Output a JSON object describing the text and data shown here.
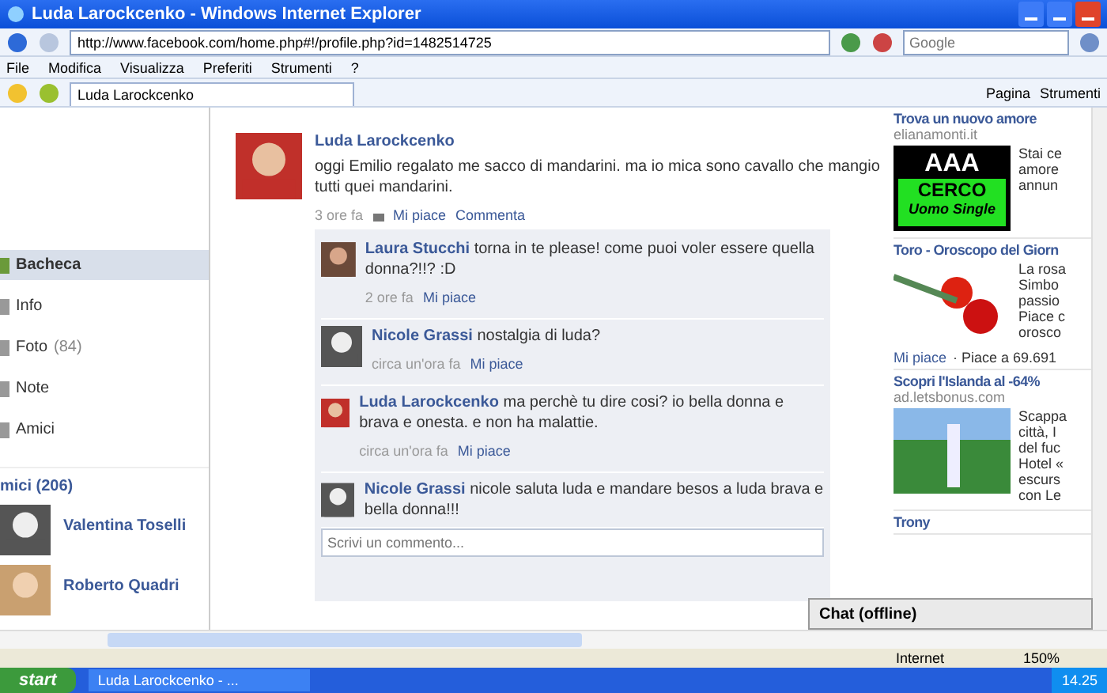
{
  "window": {
    "title": "Luda Larockcenko - Windows Internet Explorer"
  },
  "address_bar": {
    "url": "http://www.facebook.com/home.php#!/profile.php?id=1482514725",
    "search_placeholder": "Google"
  },
  "menu": [
    "File",
    "Modifica",
    "Visualizza",
    "Preferiti",
    "Strumenti",
    "?"
  ],
  "tabs": [
    {
      "label": "Luda Larockcenko",
      "selected": true
    }
  ],
  "command_bar": [
    "Pagina",
    "Strumenti"
  ],
  "sidebar": {
    "items": [
      {
        "label": "Bacheca",
        "selected": true
      },
      {
        "label": "Info",
        "selected": false
      },
      {
        "label": "Foto",
        "count": "(84)",
        "selected": false
      },
      {
        "label": "Note",
        "selected": false
      },
      {
        "label": "Amici",
        "selected": false
      }
    ],
    "friends_title": "mici (206)",
    "friends": [
      {
        "name": "Valentina Toselli"
      },
      {
        "name": "Roberto Quadri"
      }
    ]
  },
  "post": {
    "author": "Luda Larockcenko",
    "text": "oggi Emilio regalato me sacco di mandarini. ma io mica sono cavallo che mangio tutti  quei mandarini.",
    "time": "3 ore fa",
    "like": "Mi piace",
    "comment": "Commenta",
    "comments": [
      {
        "author": "Laura Stucchi",
        "text": "torna in te please!  come puoi voler essere quella donna?!!? :D",
        "time": "2 ore fa",
        "like": "Mi piace"
      },
      {
        "author": "Nicole Grassi",
        "text": "nostalgia di luda?",
        "time": "circa un'ora fa",
        "like": "Mi piace"
      },
      {
        "author": "Luda Larockcenko",
        "text": "ma perchè tu  dire cosi? io bella donna e brava e onesta.  e non ha malattie.",
        "time": "circa un'ora fa",
        "like": "Mi piace"
      },
      {
        "author": "Nicole Grassi",
        "text": "nicole saluta luda e mandare besos a luda brava e bella donna!!!"
      }
    ],
    "input_placeholder": "Scrivi un commento..."
  },
  "ads": [
    {
      "title": "Trova un nuovo amore",
      "source": "elianamonti.it",
      "banner": [
        "AAA",
        "CERCO",
        "Uomo Single"
      ],
      "lines": [
        "Stai ce",
        "amore",
        "annun"
      ]
    },
    {
      "title": "Toro - Oroscopo del Giorn",
      "lines": [
        "La rosa",
        "Simbo",
        "passio",
        "Piace c",
        "orosco"
      ],
      "like": "Mi piace",
      "likes_count": "· Piace a 69.691"
    },
    {
      "title": "Scopri l'Islanda al -64%",
      "source": "ad.letsbonus.com",
      "lines": [
        "Scappa",
        "città, I",
        "del fuc",
        "Hotel «",
        "escurs",
        "con Le"
      ]
    },
    {
      "title": "Trony"
    }
  ],
  "chat": {
    "label": "Chat (offline)"
  },
  "status_bar": {
    "zone": "Internet",
    "zoom": "150%"
  },
  "taskbar": {
    "start": "start",
    "task": "Luda Larockcenko - ...",
    "time": "14.25"
  }
}
